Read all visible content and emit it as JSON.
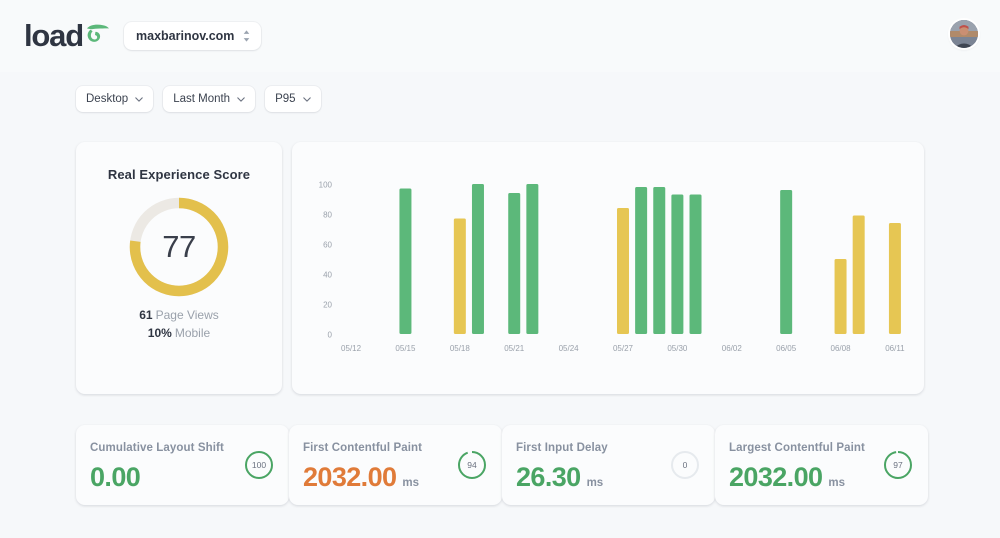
{
  "header": {
    "logo_text": "load",
    "logo_mark": "sigma-swoosh-icon",
    "domain_selector": {
      "value": "maxbarinov.com",
      "icon": "selector-up-down-icon"
    },
    "avatar": "user-avatar"
  },
  "filters": [
    {
      "label": "Desktop",
      "icon": "chevron-down-icon"
    },
    {
      "label": "Last Month",
      "icon": "chevron-down-icon"
    },
    {
      "label": "P95",
      "icon": "chevron-down-icon"
    }
  ],
  "real_experience": {
    "title": "Real Experience Score",
    "score": "77",
    "score_value": 77,
    "arc_color": "#e3c04c",
    "track_color": "#ece9e4",
    "stats": [
      {
        "value": "61",
        "label": "Page Views"
      },
      {
        "value": "10%",
        "label": "Mobile"
      }
    ]
  },
  "metrics": [
    {
      "label": "Cumulative Layout Shift",
      "value": "0.00",
      "unit": "",
      "value_color": "#4aa564",
      "ring_value": "100",
      "ring_pct": 100,
      "ring_color": "#4aa564"
    },
    {
      "label": "First Contentful Paint",
      "value": "2032.00",
      "unit": "ms",
      "value_color": "#e07b39",
      "ring_value": "94",
      "ring_pct": 94,
      "ring_color": "#4aa564"
    },
    {
      "label": "First Input Delay",
      "value": "26.30",
      "unit": "ms",
      "value_color": "#4aa564",
      "ring_value": "0",
      "ring_pct": 0,
      "ring_color": "#dfe3e8"
    },
    {
      "label": "Largest Contentful Paint",
      "value": "2032.00",
      "unit": "ms",
      "value_color": "#4aa564",
      "ring_value": "97",
      "ring_pct": 97,
      "ring_color": "#4aa564"
    }
  ],
  "chart_data": {
    "type": "bar",
    "title": "",
    "xlabel": "",
    "ylabel": "",
    "ylim": [
      0,
      100
    ],
    "yticks": [
      0,
      20,
      40,
      60,
      80,
      100
    ],
    "grid": false,
    "legend": false,
    "xticks": [
      "05/12",
      "05/15",
      "05/18",
      "05/21",
      "05/24",
      "05/27",
      "05/30",
      "06/02",
      "06/05",
      "06/08",
      "06/11"
    ],
    "colors": {
      "good": "#5cb87a",
      "needs_improvement": "#e6c653"
    },
    "categories": [
      "05/12",
      "05/13",
      "05/14",
      "05/15",
      "05/16",
      "05/17",
      "05/18",
      "05/19",
      "05/20",
      "05/21",
      "05/22",
      "05/23",
      "05/24",
      "05/25",
      "05/26",
      "05/27",
      "05/28",
      "05/29",
      "05/30",
      "05/31",
      "06/01",
      "06/02",
      "06/03",
      "06/04",
      "06/05",
      "06/06",
      "06/07",
      "06/08",
      "06/09",
      "06/10",
      "06/11"
    ],
    "values": [
      null,
      null,
      null,
      97,
      null,
      null,
      77,
      100,
      null,
      94,
      100,
      null,
      null,
      null,
      null,
      84,
      98,
      98,
      93,
      93,
      null,
      null,
      null,
      null,
      96,
      null,
      null,
      50,
      79,
      null,
      74
    ],
    "bars": [
      {
        "x": "05/15",
        "value": 97,
        "color": "good"
      },
      {
        "x": "05/18",
        "value": 77,
        "color": "needs_improvement"
      },
      {
        "x": "05/19",
        "value": 100,
        "color": "good"
      },
      {
        "x": "05/21",
        "value": 94,
        "color": "good"
      },
      {
        "x": "05/22",
        "value": 100,
        "color": "good"
      },
      {
        "x": "05/27",
        "value": 84,
        "color": "needs_improvement"
      },
      {
        "x": "05/28",
        "value": 98,
        "color": "good"
      },
      {
        "x": "05/29",
        "value": 98,
        "color": "good"
      },
      {
        "x": "05/30",
        "value": 93,
        "color": "good"
      },
      {
        "x": "05/31",
        "value": 93,
        "color": "good"
      },
      {
        "x": "06/05",
        "value": 96,
        "color": "good"
      },
      {
        "x": "06/08",
        "value": 50,
        "color": "needs_improvement"
      },
      {
        "x": "06/09",
        "value": 79,
        "color": "needs_improvement"
      },
      {
        "x": "06/11",
        "value": 74,
        "color": "needs_improvement"
      }
    ]
  }
}
